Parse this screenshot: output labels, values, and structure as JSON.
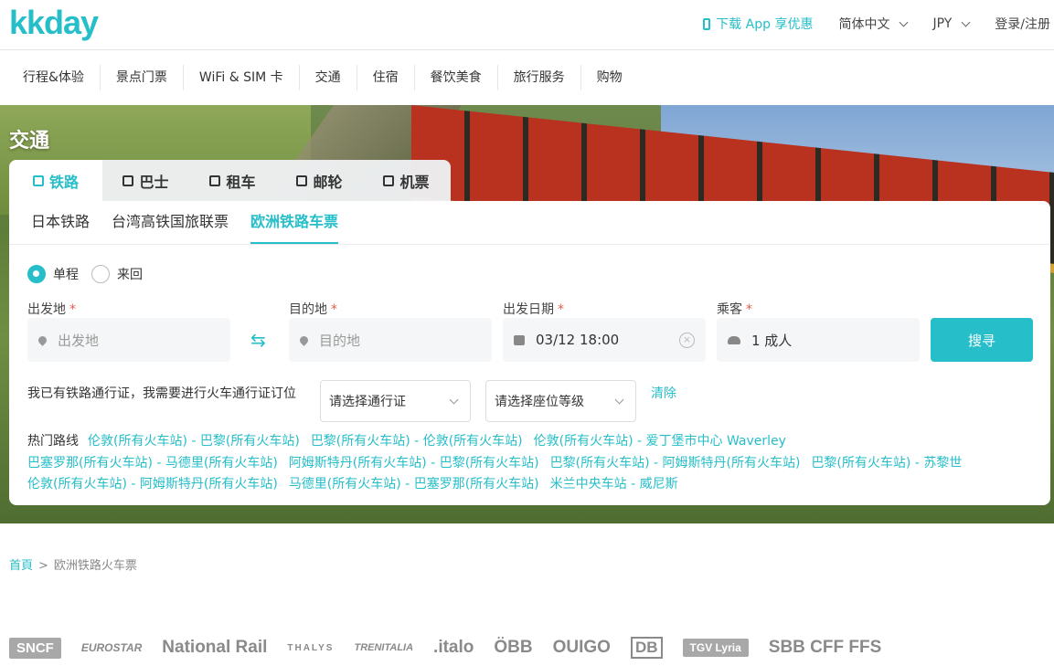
{
  "header": {
    "logo": "kkday",
    "app_link": "下载 App 享优惠",
    "language": "简体中文",
    "currency": "JPY",
    "login": "登录/注册"
  },
  "categories": [
    "行程&体验",
    "景点门票",
    "WiFi & SIM 卡",
    "交通",
    "住宿",
    "餐饮美食",
    "旅行服务",
    "购物"
  ],
  "hero": {
    "title": "交通"
  },
  "tabs": [
    {
      "label": "铁路",
      "icon": "train-icon"
    },
    {
      "label": "巴士",
      "icon": "bus-icon"
    },
    {
      "label": "租车",
      "icon": "car-icon"
    },
    {
      "label": "邮轮",
      "icon": "ship-icon"
    },
    {
      "label": "机票",
      "icon": "plane-icon"
    }
  ],
  "subtabs": [
    "日本铁路",
    "台湾高铁国旅联票",
    "欧洲铁路车票"
  ],
  "trip_type": {
    "one_way": "单程",
    "round_trip": "来回"
  },
  "form": {
    "origin_label": "出发地",
    "origin_placeholder": "出发地",
    "dest_label": "目的地",
    "dest_placeholder": "目的地",
    "date_label": "出发日期",
    "date_value": "03/12 18:00",
    "passenger_label": "乘客",
    "passenger_value": "1 成人",
    "required_mark": "*",
    "search_label": "搜寻",
    "swap_glyph": "⇆",
    "clear_glyph": "×"
  },
  "pass": {
    "label": "我已有铁路通行证，我需要进行火车通行证订位",
    "pass_select": "请选择通行证",
    "seat_select": "请选择座位等级",
    "clear": "清除"
  },
  "hot_routes": {
    "label": "热门路线",
    "routes": [
      "伦敦(所有火车站) - 巴黎(所有火车站)",
      "巴黎(所有火车站) - 伦敦(所有火车站)",
      "伦敦(所有火车站) - 爱丁堡市中心 Waverley",
      "巴塞罗那(所有火车站) - 马德里(所有火车站)",
      "阿姆斯特丹(所有火车站) - 巴黎(所有火车站)",
      "巴黎(所有火车站) - 阿姆斯特丹(所有火车站)",
      "巴黎(所有火车站) - 苏黎世",
      "伦敦(所有火车站) - 阿姆斯特丹(所有火车站)",
      "马德里(所有火车站) - 巴塞罗那(所有火车站)",
      "米兰中央车站 - 威尼斯"
    ]
  },
  "breadcrumb": {
    "home": "首頁",
    "sep": ">",
    "current": "欧洲铁路火车票"
  },
  "partners": [
    "SNCF",
    "EUROSTAR",
    "National Rail",
    "THALYS",
    "TRENITALIA",
    ".italo",
    "ÖBB",
    "OUIGO",
    "DB",
    "TGV Lyria",
    "SBB CFF FFS"
  ],
  "colors": {
    "accent": "#26bec9",
    "required": "#e85a4f"
  }
}
